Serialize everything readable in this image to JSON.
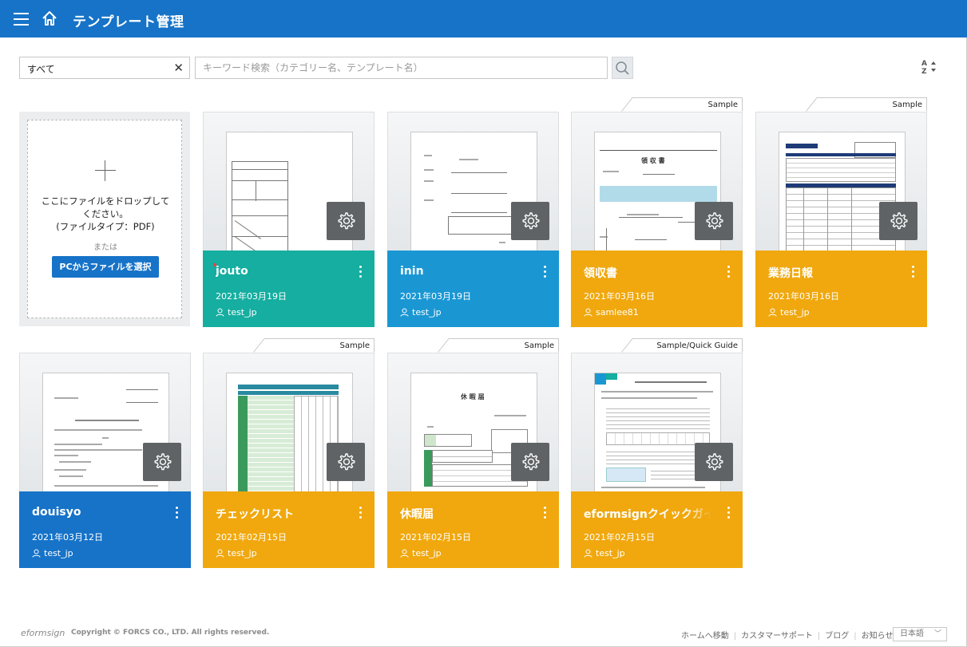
{
  "header": {
    "title": "テンプレート管理"
  },
  "toolbar": {
    "category_value": "すべて",
    "clear": "✕",
    "search_placeholder": "キーワード検索（カテゴリー名、テンプレート名）"
  },
  "upload": {
    "message_line1": "ここにファイルをドロップして",
    "message_line2": "ください。",
    "message_line3": "(ファイルタイプ：PDF)",
    "or": "または",
    "button": "PCからファイルを選択"
  },
  "templates": [
    {
      "name": "jouto",
      "date": "2021年03月19日",
      "user": "test_jp",
      "color": "#15aea0",
      "tag": ""
    },
    {
      "name": "inin",
      "date": "2021年03月19日",
      "user": "test_jp",
      "color": "#1a97d3",
      "tag": ""
    },
    {
      "name": "領収書",
      "date": "2021年03月16日",
      "user": "samlee81",
      "color": "#f0a80e",
      "tag": "Sample"
    },
    {
      "name": "業務日報",
      "date": "2021年03月16日",
      "user": "test_jp",
      "color": "#f0a80e",
      "tag": "Sample"
    },
    {
      "name": "douisyo",
      "date": "2021年03月12日",
      "user": "test_jp",
      "color": "#1673c8",
      "tag": ""
    },
    {
      "name": "チェックリスト",
      "date": "2021年02月15日",
      "user": "test_jp",
      "color": "#f0a80e",
      "tag": "Sample"
    },
    {
      "name": "休暇届",
      "date": "2021年02月15日",
      "user": "test_jp",
      "color": "#f0a80e",
      "tag": "Sample"
    },
    {
      "name": "eformsignクイックガイド",
      "date": "2021年02月15日",
      "user": "test_jp",
      "color": "#f0a80e",
      "tag": "Sample/Quick Guide"
    }
  ],
  "thumbnails": {
    "receipt_title": "領 収 書",
    "leave_title": "休 暇 届"
  },
  "footer": {
    "logo": "eformsign",
    "copyright": "Copyright © FORCS CO., LTD. All rights reserved.",
    "links": [
      "ホームへ移動",
      "カスタマーサポート",
      "ブログ",
      "お知らせ"
    ],
    "language": "日本語"
  }
}
